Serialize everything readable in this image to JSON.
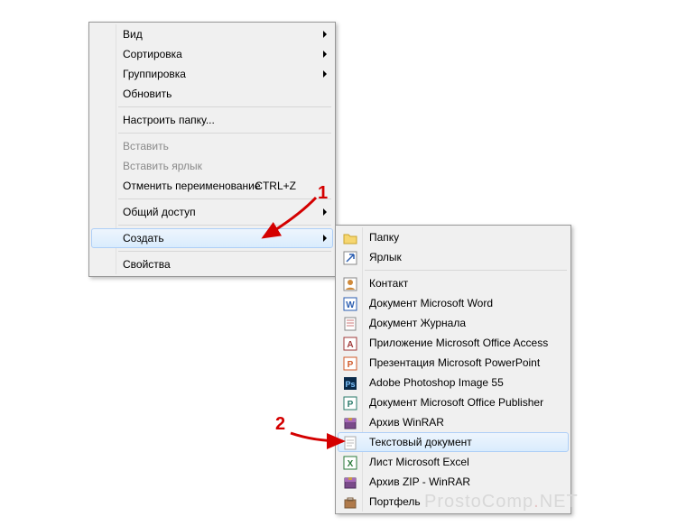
{
  "mainMenu": {
    "items": [
      {
        "label": "Вид",
        "hasSubmenu": true
      },
      {
        "label": "Сортировка",
        "hasSubmenu": true
      },
      {
        "label": "Группировка",
        "hasSubmenu": true
      },
      {
        "label": "Обновить"
      },
      {
        "sep": true
      },
      {
        "label": "Настроить папку..."
      },
      {
        "sep": true
      },
      {
        "label": "Вставить",
        "disabled": true
      },
      {
        "label": "Вставить ярлык",
        "disabled": true
      },
      {
        "label": "Отменить переименование",
        "shortcut": "CTRL+Z"
      },
      {
        "sep": true
      },
      {
        "label": "Общий доступ",
        "hasSubmenu": true
      },
      {
        "sep": true
      },
      {
        "label": "Создать",
        "hasSubmenu": true,
        "highlight": true
      },
      {
        "sep": true
      },
      {
        "label": "Свойства"
      }
    ]
  },
  "subMenu": {
    "items": [
      {
        "label": "Папку",
        "icon": "folder"
      },
      {
        "label": "Ярлык",
        "icon": "shortcut"
      },
      {
        "sep": true
      },
      {
        "label": "Контакт",
        "icon": "contact"
      },
      {
        "label": "Документ Microsoft Word",
        "icon": "word"
      },
      {
        "label": "Документ Журнала",
        "icon": "journal"
      },
      {
        "label": "Приложение Microsoft Office Access",
        "icon": "access"
      },
      {
        "label": "Презентация Microsoft PowerPoint",
        "icon": "powerpoint"
      },
      {
        "label": "Adobe Photoshop Image 55",
        "icon": "photoshop"
      },
      {
        "label": "Документ Microsoft Office Publisher",
        "icon": "publisher"
      },
      {
        "label": "Архив WinRAR",
        "icon": "winrar"
      },
      {
        "label": "Текстовый документ",
        "icon": "text",
        "highlight": true
      },
      {
        "label": "Лист Microsoft Excel",
        "icon": "excel"
      },
      {
        "label": "Архив ZIP - WinRAR",
        "icon": "winrar"
      },
      {
        "label": "Портфель",
        "icon": "briefcase"
      }
    ]
  },
  "annotations": {
    "num1": "1",
    "num2": "2"
  },
  "watermark": {
    "left": "ProstoComp",
    "right": "NET"
  }
}
